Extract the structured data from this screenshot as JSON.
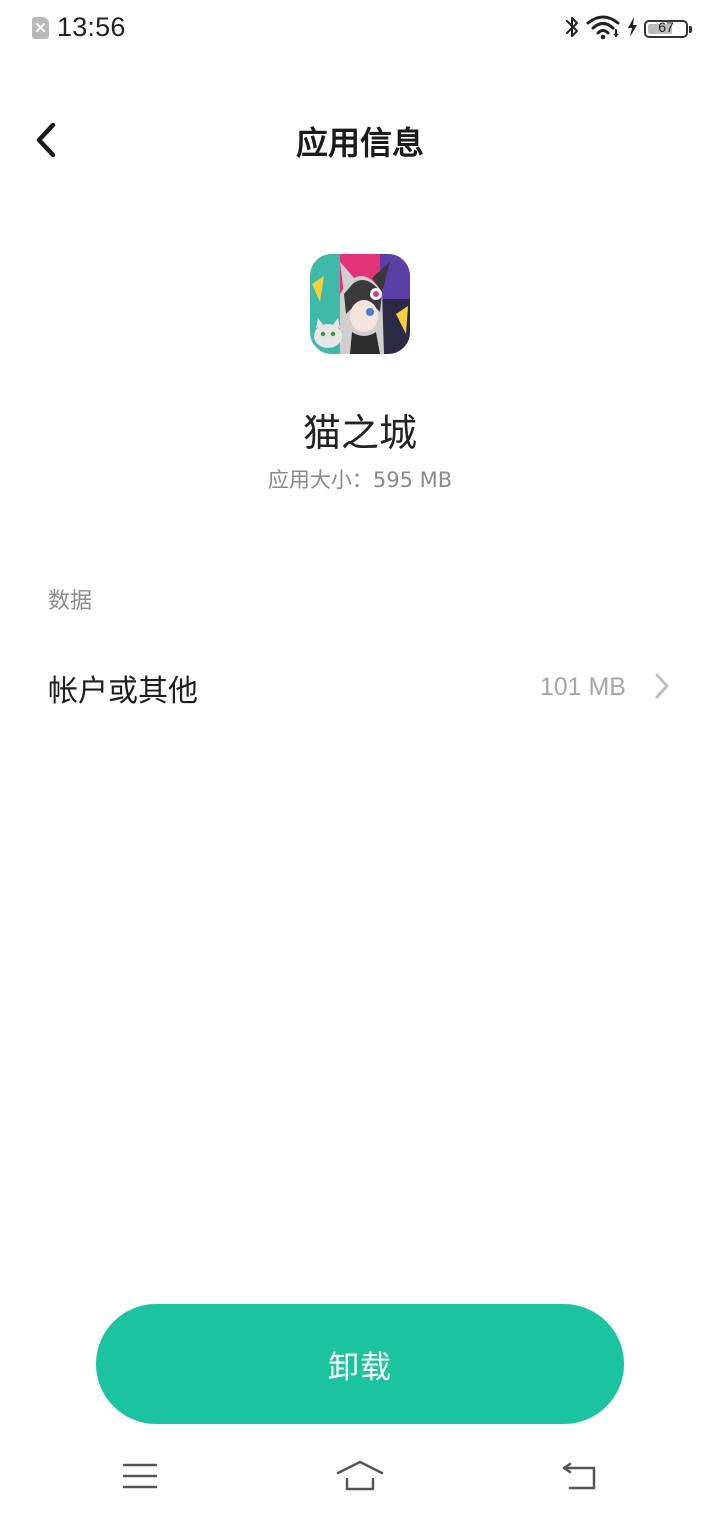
{
  "status_bar": {
    "time": "13:56",
    "battery_level": "67",
    "battery_fraction": 0.67,
    "icons": [
      "sim-error-icon",
      "bluetooth-icon",
      "wifi-icon",
      "charging-icon",
      "battery-icon"
    ]
  },
  "header": {
    "title": "应用信息",
    "back_icon": "chevron-left-icon"
  },
  "app": {
    "name": "猫之城",
    "size_text": "应用大小：595 MB",
    "icon": "app-icon-cat-girl"
  },
  "data_section": {
    "title": "数据",
    "items": [
      {
        "label": "帐户或其他",
        "value": "101 MB",
        "icon": "chevron-right-icon"
      }
    ]
  },
  "actions": {
    "uninstall_label": "卸载"
  },
  "nav_bar": {
    "icons": [
      "menu-icon",
      "home-icon",
      "back-icon"
    ]
  },
  "colors": {
    "accent": "#1bc39e",
    "secondary_text": "#8a8a8a",
    "value_text": "#a6a6a6"
  }
}
